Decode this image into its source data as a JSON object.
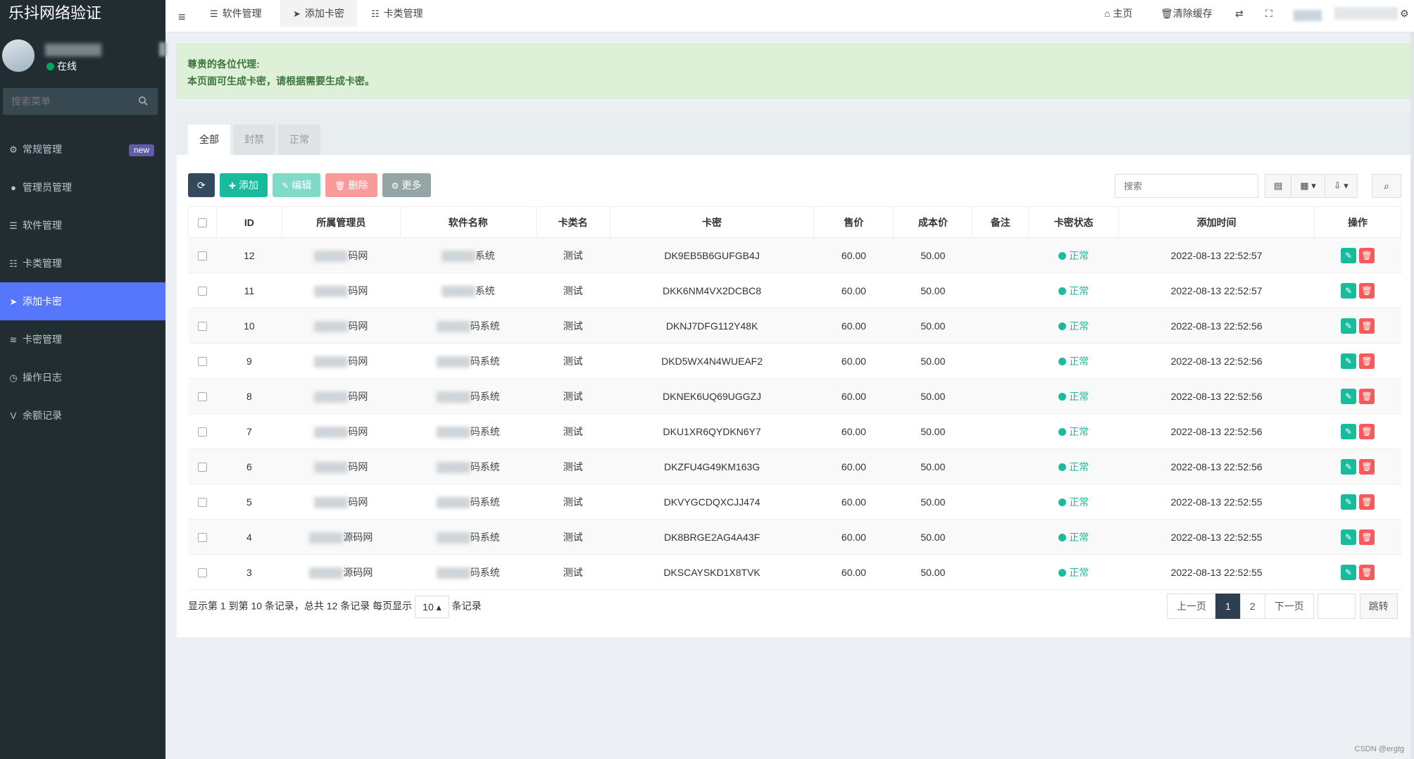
{
  "app": {
    "title": "乐抖网络验证",
    "title_suffix": ""
  },
  "user": {
    "status": "在线",
    "status_color": "#00a65a"
  },
  "sidebar": {
    "search_placeholder": "搜索菜单",
    "items": [
      {
        "label": "常规管理",
        "icon": "cogs-icon",
        "glyph": "⚙",
        "badge": "new"
      },
      {
        "label": "管理员管理",
        "icon": "user-icon",
        "glyph": "●"
      },
      {
        "label": "软件管理",
        "icon": "list-icon",
        "glyph": "☰"
      },
      {
        "label": "卡类管理",
        "icon": "list-alt-icon",
        "glyph": "☷"
      },
      {
        "label": "添加卡密",
        "icon": "paper-plane-icon",
        "glyph": "➤",
        "active": true
      },
      {
        "label": "卡密管理",
        "icon": "rss-icon",
        "glyph": "≋"
      },
      {
        "label": "操作日志",
        "icon": "clock-icon",
        "glyph": "◷"
      },
      {
        "label": "余额记录",
        "icon": "vimeo-icon",
        "glyph": "V"
      }
    ]
  },
  "topbar": {
    "tabs": [
      {
        "label": "软件管理",
        "icon": "list-icon"
      },
      {
        "label": "添加卡密",
        "icon": "paper-plane-icon",
        "active": true
      },
      {
        "label": "卡类管理",
        "icon": "list-alt-icon"
      }
    ],
    "home": "主页",
    "clear_cache": "清除缓存"
  },
  "notice": {
    "line1": "尊贵的各位代理:",
    "line2": "本页面可生成卡密，请根据需要生成卡密。"
  },
  "filter_tabs": [
    "全部",
    "封禁",
    "正常"
  ],
  "toolbar": {
    "add": "添加",
    "edit": "编辑",
    "delete": "删除",
    "more": "更多"
  },
  "table_search_placeholder": "搜索",
  "columns": [
    "ID",
    "所属管理员",
    "软件名称",
    "卡类名",
    "卡密",
    "售价",
    "成本价",
    "备注",
    "卡密状态",
    "添加时间",
    "操作"
  ],
  "rows": [
    {
      "id": "12",
      "admin": "码网",
      "software": "系统",
      "type": "测试",
      "key": "DK9EB5B6GUFGB4J",
      "price": "60.00",
      "cost": "50.00",
      "remark": "",
      "status": "正常",
      "time": "2022-08-13 22:52:57"
    },
    {
      "id": "11",
      "admin": "码网",
      "software": "系统",
      "type": "测试",
      "key": "DKK6NM4VX2DCBC8",
      "price": "60.00",
      "cost": "50.00",
      "remark": "",
      "status": "正常",
      "time": "2022-08-13 22:52:57"
    },
    {
      "id": "10",
      "admin": "码网",
      "software": "码系统",
      "type": "测试",
      "key": "DKNJ7DFG112Y48K",
      "price": "60.00",
      "cost": "50.00",
      "remark": "",
      "status": "正常",
      "time": "2022-08-13 22:52:56"
    },
    {
      "id": "9",
      "admin": "码网",
      "software": "码系统",
      "type": "测试",
      "key": "DKD5WX4N4WUEAF2",
      "price": "60.00",
      "cost": "50.00",
      "remark": "",
      "status": "正常",
      "time": "2022-08-13 22:52:56"
    },
    {
      "id": "8",
      "admin": "码网",
      "software": "码系统",
      "type": "测试",
      "key": "DKNEK6UQ69UGGZJ",
      "price": "60.00",
      "cost": "50.00",
      "remark": "",
      "status": "正常",
      "time": "2022-08-13 22:52:56"
    },
    {
      "id": "7",
      "admin": "码网",
      "software": "码系统",
      "type": "测试",
      "key": "DKU1XR6QYDKN6Y7",
      "price": "60.00",
      "cost": "50.00",
      "remark": "",
      "status": "正常",
      "time": "2022-08-13 22:52:56"
    },
    {
      "id": "6",
      "admin": "码网",
      "software": "码系统",
      "type": "测试",
      "key": "DKZFU4G49KM163G",
      "price": "60.00",
      "cost": "50.00",
      "remark": "",
      "status": "正常",
      "time": "2022-08-13 22:52:56"
    },
    {
      "id": "5",
      "admin": "码网",
      "software": "码系统",
      "type": "测试",
      "key": "DKVYGCDQXCJJ474",
      "price": "60.00",
      "cost": "50.00",
      "remark": "",
      "status": "正常",
      "time": "2022-08-13 22:52:55"
    },
    {
      "id": "4",
      "admin": "源码网",
      "software": "码系统",
      "type": "测试",
      "key": "DK8BRGE2AG4A43F",
      "price": "60.00",
      "cost": "50.00",
      "remark": "",
      "status": "正常",
      "time": "2022-08-13 22:52:55"
    },
    {
      "id": "3",
      "admin": "源码网",
      "software": "码系统",
      "type": "测试",
      "key": "DKSCAYSKD1X8TVK",
      "price": "60.00",
      "cost": "50.00",
      "remark": "",
      "status": "正常",
      "time": "2022-08-13 22:52:55"
    }
  ],
  "footer": {
    "summary": "显示第 1 到第 10 条记录，总共 12 条记录 每页显示",
    "page_size": "10",
    "suffix": "条记录"
  },
  "pagination": {
    "prev": "上一页",
    "pages": [
      "1",
      "2"
    ],
    "current": "1",
    "next": "下一页",
    "go": "跳转"
  },
  "watermark": "CSDN @ergtg",
  "colors": {
    "sidebar_bg": "#222d32",
    "active_menu": "#5677fc",
    "success": "#18bc9c",
    "danger": "#f75a5a",
    "notice_bg": "#dff0d8"
  }
}
